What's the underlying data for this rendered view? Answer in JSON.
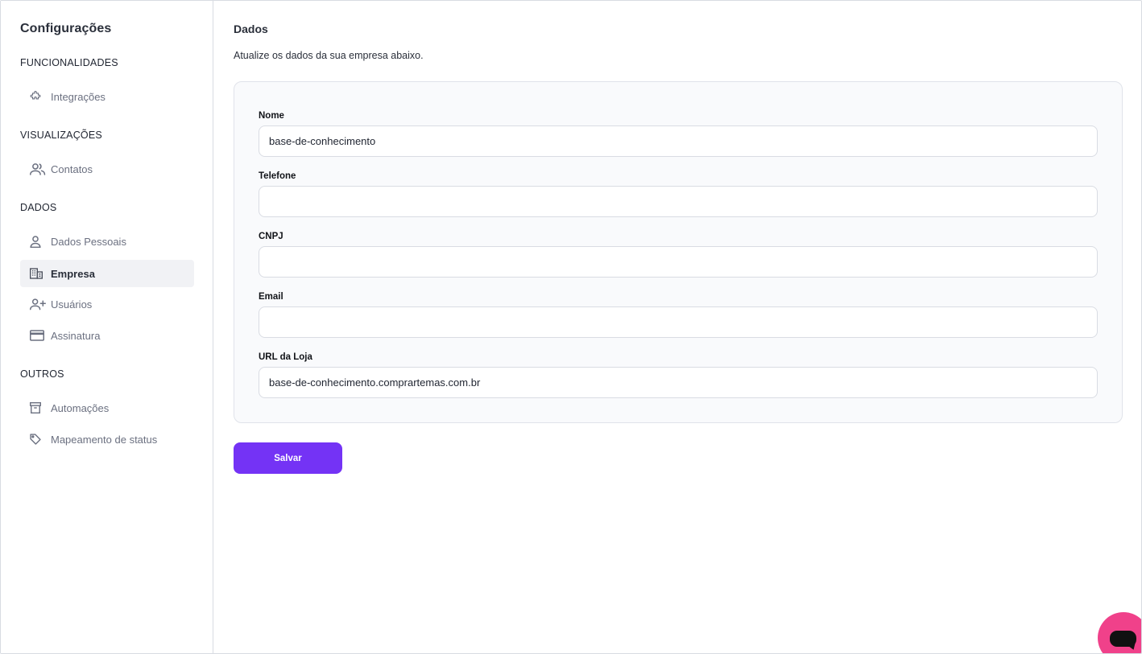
{
  "sidebar": {
    "title": "Configurações",
    "sections": [
      {
        "label": "FUNCIONALIDADES",
        "items": [
          {
            "label": "Integrações",
            "icon": "puzzle-icon"
          }
        ]
      },
      {
        "label": "VISUALIZAÇÕES",
        "items": [
          {
            "label": "Contatos",
            "icon": "users-icon"
          }
        ]
      },
      {
        "label": "DADOS",
        "items": [
          {
            "label": "Dados Pessoais",
            "icon": "user-icon"
          },
          {
            "label": "Empresa",
            "icon": "building-icon",
            "active": true
          },
          {
            "label": "Usuários",
            "icon": "user-plus-icon"
          },
          {
            "label": "Assinatura",
            "icon": "credit-card-icon"
          }
        ]
      },
      {
        "label": "OUTROS",
        "items": [
          {
            "label": "Automações",
            "icon": "archive-icon"
          },
          {
            "label": "Mapeamento de status",
            "icon": "tag-icon"
          }
        ]
      }
    ]
  },
  "main": {
    "title": "Dados",
    "subtitle": "Atualize os dados da sua empresa abaixo.",
    "fields": [
      {
        "label": "Nome",
        "value": "base-de-conhecimento",
        "placeholder": ""
      },
      {
        "label": "Telefone",
        "value": "",
        "placeholder": ""
      },
      {
        "label": "CNPJ",
        "value": "",
        "placeholder": ""
      },
      {
        "label": "Email",
        "value": "",
        "placeholder": ""
      },
      {
        "label": "URL da Loja",
        "value": "base-de-conhecimento.comprartemas.com.br",
        "placeholder": ""
      }
    ],
    "save_label": "Salvar"
  },
  "colors": {
    "accent": "#7433f5",
    "chat_launcher": "#f0418a",
    "active_nav_bg": "#f1f2f5"
  }
}
